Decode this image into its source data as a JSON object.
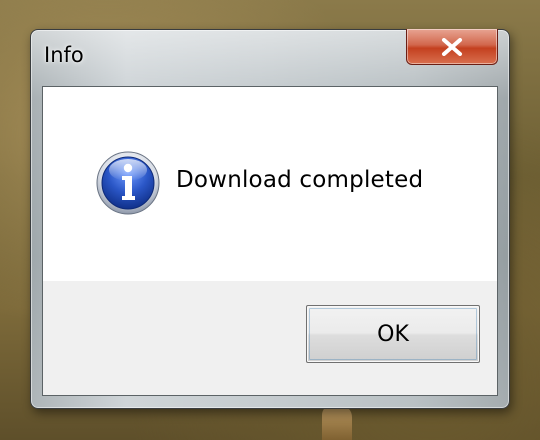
{
  "window": {
    "title": "Info"
  },
  "titlebar": {
    "close_icon": "close-icon",
    "close_color": "#c7432a"
  },
  "message": {
    "icon": "info-icon",
    "icon_color": "#2a56c6",
    "text": "Download completed"
  },
  "buttons": {
    "ok_label": "OK"
  }
}
